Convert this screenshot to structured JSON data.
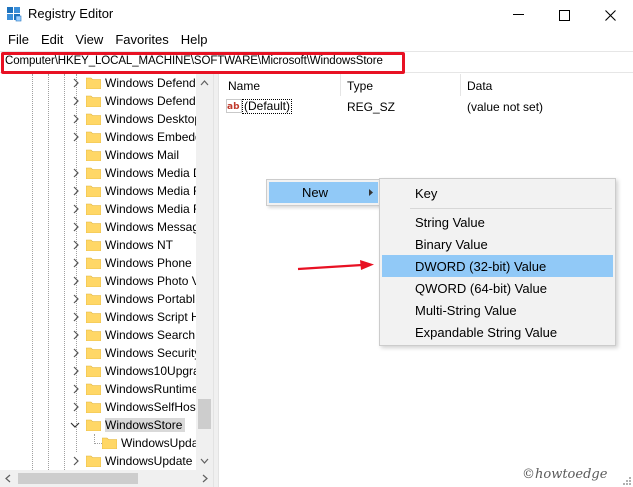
{
  "window": {
    "title": "Registry Editor"
  },
  "menu": [
    "File",
    "Edit",
    "View",
    "Favorites",
    "Help"
  ],
  "address": {
    "path": "Computer\\HKEY_LOCAL_MACHINE\\SOFTWARE\\Microsoft\\WindowsStore"
  },
  "tree": {
    "items": [
      "Windows Defend",
      "Windows Defend",
      "Windows Desktop",
      "Windows Embedd",
      "Windows Mail",
      "Windows Media D",
      "Windows Media F",
      "Windows Media F",
      "Windows Messag",
      "Windows NT",
      "Windows Phone",
      "Windows Photo V",
      "Windows Portabl",
      "Windows Script H",
      "Windows Search",
      "Windows Security",
      "Windows10Upgra",
      "WindowsRuntime",
      "WindowsSelfHost",
      "WindowsStore",
      "WindowsUpda",
      "WindowsUpdate"
    ]
  },
  "values": {
    "columns": [
      "Name",
      "Type",
      "Data"
    ],
    "rows": [
      {
        "name": "(Default)",
        "type": "REG_SZ",
        "data": "(value not set)"
      }
    ]
  },
  "context_menu": {
    "new_label": "New"
  },
  "submenu": {
    "items": [
      "Key",
      "String Value",
      "Binary Value",
      "DWORD (32-bit) Value",
      "QWORD (64-bit) Value",
      "Multi-String Value",
      "Expandable String Value"
    ]
  },
  "watermark": "©howtoedge",
  "colors": {
    "highlight": "#91c9f7",
    "annotation_red": "#e81123",
    "folder": "#ffd766"
  }
}
